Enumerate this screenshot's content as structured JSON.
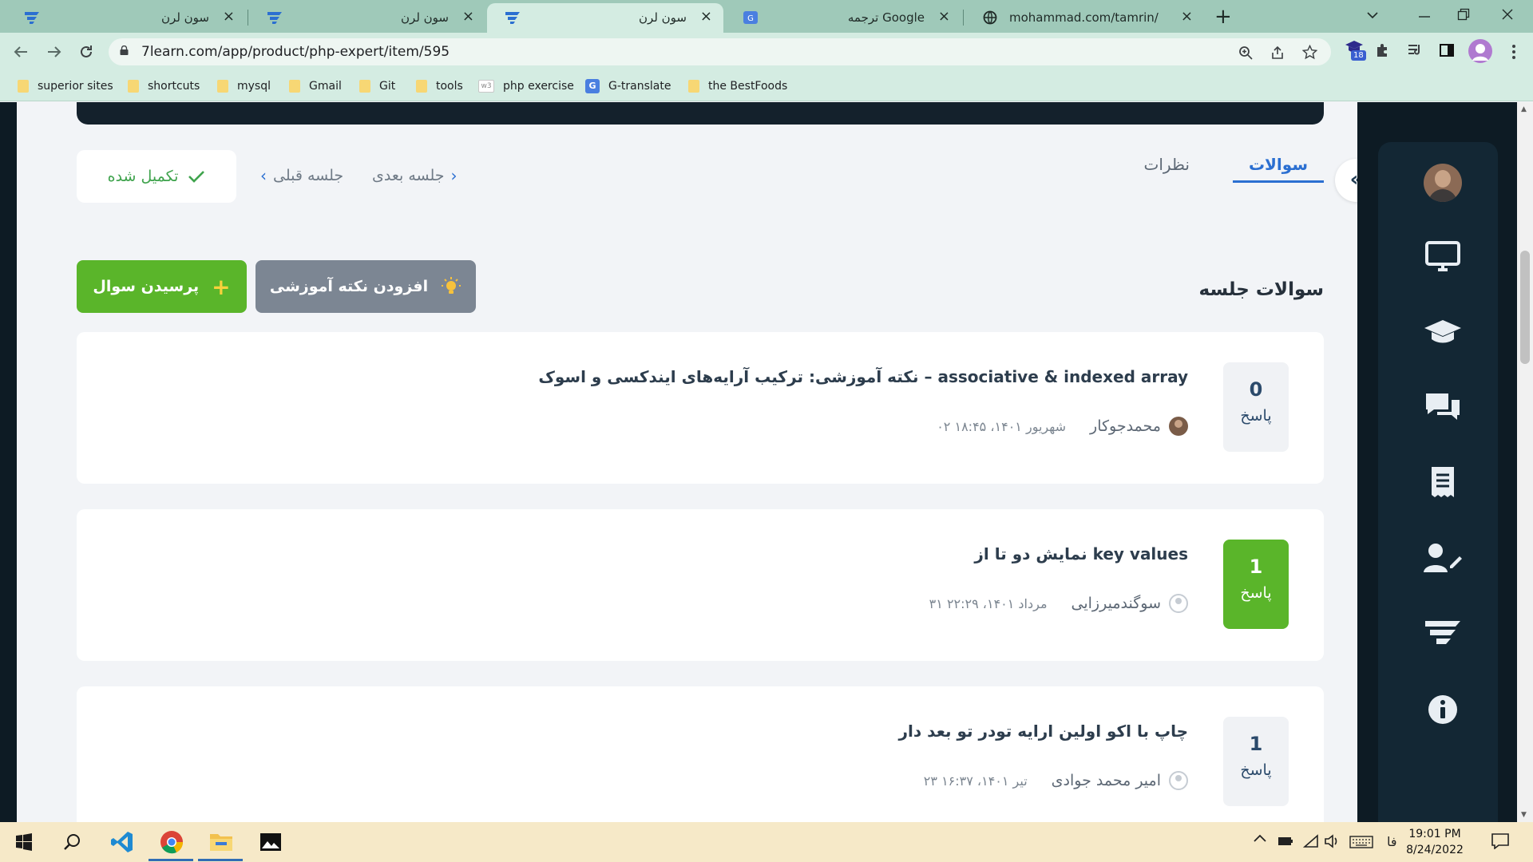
{
  "browser": {
    "tabs": [
      {
        "title": "سون لرن",
        "active": false
      },
      {
        "title": "سون لرن",
        "active": false
      },
      {
        "title": "سون لرن",
        "active": true
      },
      {
        "title": "ترجمه Google",
        "active": false
      },
      {
        "title": "mohammad.com/tamrin/",
        "active": false
      }
    ],
    "close_glyph": "×",
    "new_tab_glyph": "+",
    "url": "7learn.com/app/product/php-expert/item/595",
    "extension_badge": "18",
    "bookmarks": [
      {
        "label": "superior sites",
        "icon": "folder-icon"
      },
      {
        "label": "shortcuts",
        "icon": "folder-icon"
      },
      {
        "label": "mysql",
        "icon": "folder-icon"
      },
      {
        "label": "Gmail",
        "icon": "folder-icon"
      },
      {
        "label": "Git",
        "icon": "folder-icon"
      },
      {
        "label": "tools",
        "icon": "folder-icon"
      },
      {
        "label": "php exercise",
        "icon": "w3schools-icon"
      },
      {
        "label": "G-translate",
        "icon": "google-translate-icon"
      },
      {
        "label": "the BestFoods",
        "icon": "folder-icon"
      }
    ]
  },
  "page": {
    "completed_label": "تکمیل شده",
    "prev_session": "جلسه قبلی",
    "next_session": "جلسه بعدی",
    "tabs": [
      {
        "label": "سوالات",
        "active": true
      },
      {
        "label": "نظرات",
        "active": false
      }
    ],
    "section_title": "سوالات جلسه",
    "ask_button": "پرسیدن سوال",
    "tip_button": "افزودن نکته آموزشی",
    "answers_label": "پاسخ",
    "questions": [
      {
        "title": "نکته آموزشی: ترکیب آرایه‌های ایندکسی و اسوک – associative & indexed array",
        "author": "محمدجوکار",
        "date": "۰۲ شهریور ۱۴۰۱، ۱۸:۴۵",
        "answers": "0",
        "highlight": false,
        "avatar": "photo"
      },
      {
        "title": "نمایش دو تا از key values",
        "author": "سوگندمیرزایی",
        "date": "۳۱ مرداد ۱۴۰۱، ۲۲:۲۹",
        "answers": "1",
        "highlight": true,
        "avatar": "blank"
      },
      {
        "title": "چاپ با اکو اولین ارایه تودر تو بعد دار",
        "author": "امیر محمد جوادی",
        "date": "۲۳ تیر ۱۴۰۱، ۱۶:۳۷",
        "answers": "1",
        "highlight": false,
        "avatar": "blank"
      }
    ]
  },
  "sidebar": {
    "icons": [
      "monitor-icon",
      "graduation-cap-icon",
      "chat-icon",
      "receipt-icon",
      "user-edit-icon",
      "sevenlearn-logo-icon",
      "info-icon"
    ]
  },
  "taskbar": {
    "language": "فا",
    "time": "19:01 PM",
    "date": "8/24/2022"
  },
  "colors": {
    "accent_blue": "#2b6fd1",
    "success_green": "#5ab52a",
    "sidebar_dark": "#0d1b24",
    "tab_strip": "#9fc9b9"
  }
}
